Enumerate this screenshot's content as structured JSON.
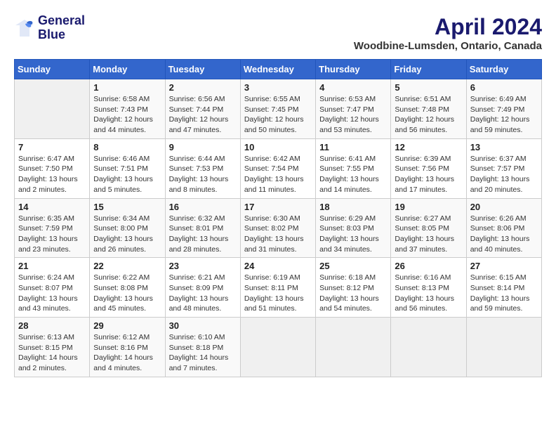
{
  "logo": {
    "line1": "General",
    "line2": "Blue"
  },
  "title": "April 2024",
  "location": "Woodbine-Lumsden, Ontario, Canada",
  "days_header": [
    "Sunday",
    "Monday",
    "Tuesday",
    "Wednesday",
    "Thursday",
    "Friday",
    "Saturday"
  ],
  "weeks": [
    [
      {
        "day": "",
        "info": ""
      },
      {
        "day": "1",
        "info": "Sunrise: 6:58 AM\nSunset: 7:43 PM\nDaylight: 12 hours\nand 44 minutes."
      },
      {
        "day": "2",
        "info": "Sunrise: 6:56 AM\nSunset: 7:44 PM\nDaylight: 12 hours\nand 47 minutes."
      },
      {
        "day": "3",
        "info": "Sunrise: 6:55 AM\nSunset: 7:45 PM\nDaylight: 12 hours\nand 50 minutes."
      },
      {
        "day": "4",
        "info": "Sunrise: 6:53 AM\nSunset: 7:47 PM\nDaylight: 12 hours\nand 53 minutes."
      },
      {
        "day": "5",
        "info": "Sunrise: 6:51 AM\nSunset: 7:48 PM\nDaylight: 12 hours\nand 56 minutes."
      },
      {
        "day": "6",
        "info": "Sunrise: 6:49 AM\nSunset: 7:49 PM\nDaylight: 12 hours\nand 59 minutes."
      }
    ],
    [
      {
        "day": "7",
        "info": "Sunrise: 6:47 AM\nSunset: 7:50 PM\nDaylight: 13 hours\nand 2 minutes."
      },
      {
        "day": "8",
        "info": "Sunrise: 6:46 AM\nSunset: 7:51 PM\nDaylight: 13 hours\nand 5 minutes."
      },
      {
        "day": "9",
        "info": "Sunrise: 6:44 AM\nSunset: 7:53 PM\nDaylight: 13 hours\nand 8 minutes."
      },
      {
        "day": "10",
        "info": "Sunrise: 6:42 AM\nSunset: 7:54 PM\nDaylight: 13 hours\nand 11 minutes."
      },
      {
        "day": "11",
        "info": "Sunrise: 6:41 AM\nSunset: 7:55 PM\nDaylight: 13 hours\nand 14 minutes."
      },
      {
        "day": "12",
        "info": "Sunrise: 6:39 AM\nSunset: 7:56 PM\nDaylight: 13 hours\nand 17 minutes."
      },
      {
        "day": "13",
        "info": "Sunrise: 6:37 AM\nSunset: 7:57 PM\nDaylight: 13 hours\nand 20 minutes."
      }
    ],
    [
      {
        "day": "14",
        "info": "Sunrise: 6:35 AM\nSunset: 7:59 PM\nDaylight: 13 hours\nand 23 minutes."
      },
      {
        "day": "15",
        "info": "Sunrise: 6:34 AM\nSunset: 8:00 PM\nDaylight: 13 hours\nand 26 minutes."
      },
      {
        "day": "16",
        "info": "Sunrise: 6:32 AM\nSunset: 8:01 PM\nDaylight: 13 hours\nand 28 minutes."
      },
      {
        "day": "17",
        "info": "Sunrise: 6:30 AM\nSunset: 8:02 PM\nDaylight: 13 hours\nand 31 minutes."
      },
      {
        "day": "18",
        "info": "Sunrise: 6:29 AM\nSunset: 8:03 PM\nDaylight: 13 hours\nand 34 minutes."
      },
      {
        "day": "19",
        "info": "Sunrise: 6:27 AM\nSunset: 8:05 PM\nDaylight: 13 hours\nand 37 minutes."
      },
      {
        "day": "20",
        "info": "Sunrise: 6:26 AM\nSunset: 8:06 PM\nDaylight: 13 hours\nand 40 minutes."
      }
    ],
    [
      {
        "day": "21",
        "info": "Sunrise: 6:24 AM\nSunset: 8:07 PM\nDaylight: 13 hours\nand 43 minutes."
      },
      {
        "day": "22",
        "info": "Sunrise: 6:22 AM\nSunset: 8:08 PM\nDaylight: 13 hours\nand 45 minutes."
      },
      {
        "day": "23",
        "info": "Sunrise: 6:21 AM\nSunset: 8:09 PM\nDaylight: 13 hours\nand 48 minutes."
      },
      {
        "day": "24",
        "info": "Sunrise: 6:19 AM\nSunset: 8:11 PM\nDaylight: 13 hours\nand 51 minutes."
      },
      {
        "day": "25",
        "info": "Sunrise: 6:18 AM\nSunset: 8:12 PM\nDaylight: 13 hours\nand 54 minutes."
      },
      {
        "day": "26",
        "info": "Sunrise: 6:16 AM\nSunset: 8:13 PM\nDaylight: 13 hours\nand 56 minutes."
      },
      {
        "day": "27",
        "info": "Sunrise: 6:15 AM\nSunset: 8:14 PM\nDaylight: 13 hours\nand 59 minutes."
      }
    ],
    [
      {
        "day": "28",
        "info": "Sunrise: 6:13 AM\nSunset: 8:15 PM\nDaylight: 14 hours\nand 2 minutes."
      },
      {
        "day": "29",
        "info": "Sunrise: 6:12 AM\nSunset: 8:16 PM\nDaylight: 14 hours\nand 4 minutes."
      },
      {
        "day": "30",
        "info": "Sunrise: 6:10 AM\nSunset: 8:18 PM\nDaylight: 14 hours\nand 7 minutes."
      },
      {
        "day": "",
        "info": ""
      },
      {
        "day": "",
        "info": ""
      },
      {
        "day": "",
        "info": ""
      },
      {
        "day": "",
        "info": ""
      }
    ]
  ]
}
